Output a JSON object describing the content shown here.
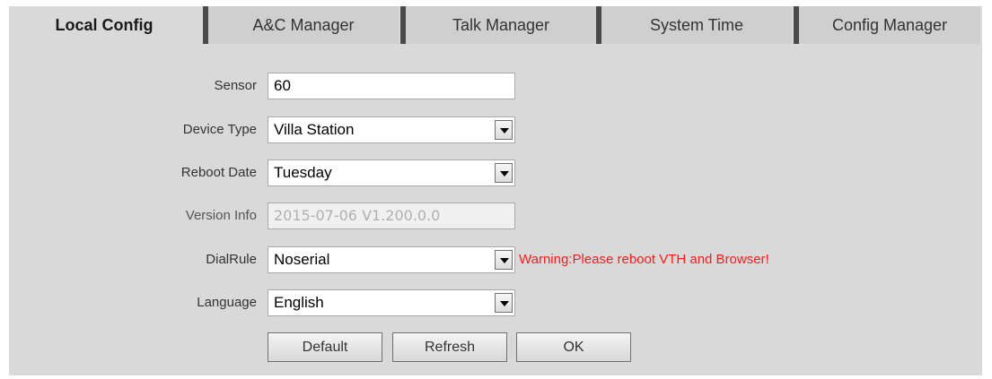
{
  "tabs": [
    {
      "label": "Local Config",
      "active": true
    },
    {
      "label": "A&C Manager",
      "active": false
    },
    {
      "label": "Talk Manager",
      "active": false
    },
    {
      "label": "System Time",
      "active": false
    },
    {
      "label": "Config Manager",
      "active": false
    }
  ],
  "form": {
    "sensor": {
      "label": "Sensor",
      "value": "60"
    },
    "device_type": {
      "label": "Device Type",
      "value": "Villa Station"
    },
    "reboot_date": {
      "label": "Reboot Date",
      "value": "Tuesday"
    },
    "version_info": {
      "label": "Version Info",
      "value": "2015-07-06 V1.200.0.0"
    },
    "dial_rule": {
      "label": "DialRule",
      "value": "Noserial",
      "warning": "Warning:Please reboot VTH and Browser!"
    },
    "language": {
      "label": "Language",
      "value": "English"
    }
  },
  "buttons": {
    "default": "Default",
    "refresh": "Refresh",
    "ok": "OK"
  },
  "colors": {
    "panel_bg": "#d9d9d9",
    "tab_separator": "#4a4a4a",
    "warning": "#ff1a1a"
  }
}
